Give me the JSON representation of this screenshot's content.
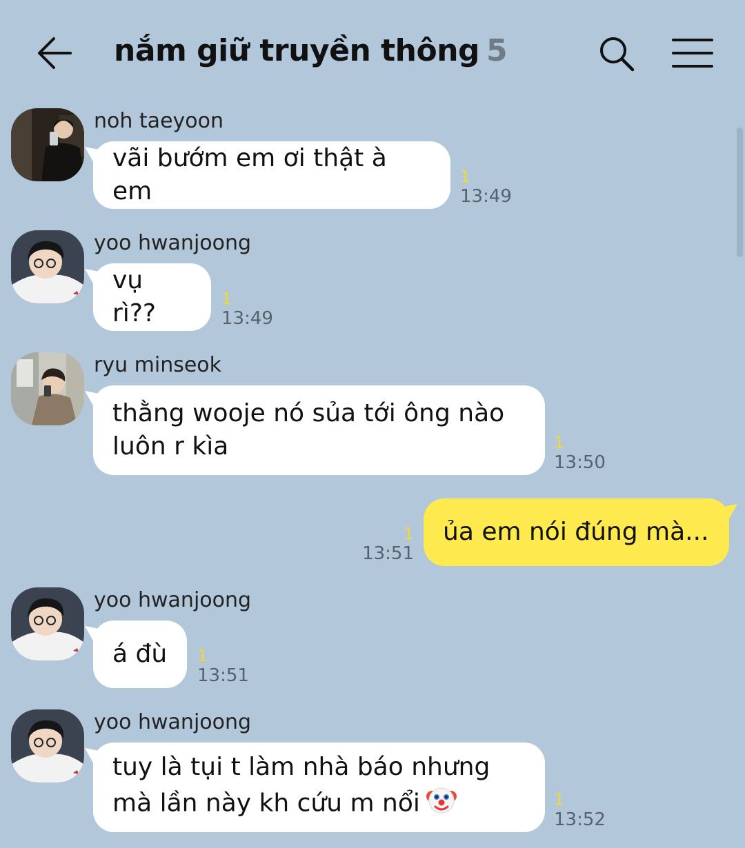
{
  "header": {
    "title": "nắm giữ truyền thông",
    "member_count": "5"
  },
  "messages": [
    {
      "sender": "noh taeyoon",
      "text": "vãi bướm em ơi thật à em",
      "unread": "1",
      "time": "13:49",
      "direction": "incoming"
    },
    {
      "sender": "yoo hwanjoong",
      "text": "vụ rì??",
      "unread": "1",
      "time": "13:49",
      "direction": "incoming"
    },
    {
      "sender": "ryu minseok",
      "text": "thằng wooje nó sủa tới ông nào\nluôn r kìa",
      "unread": "1",
      "time": "13:50",
      "direction": "incoming"
    },
    {
      "text": "ủa em nói đúng mà...",
      "unread": "1",
      "time": "13:51",
      "direction": "outgoing"
    },
    {
      "sender": "yoo hwanjoong",
      "text": "á đù",
      "unread": "1",
      "time": "13:51",
      "direction": "incoming"
    },
    {
      "sender": "yoo hwanjoong",
      "text": "tuy là tụi t làm nhà báo nhưng\nmà lần này kh cứu m nổi",
      "emoji": "clown-face-icon",
      "unread": "1",
      "time": "13:52",
      "direction": "incoming"
    }
  ],
  "colors": {
    "background": "#b2c7da",
    "incoming_bubble": "#ffffff",
    "outgoing_bubble": "#fee94e",
    "unread_count": "#f1d836"
  }
}
